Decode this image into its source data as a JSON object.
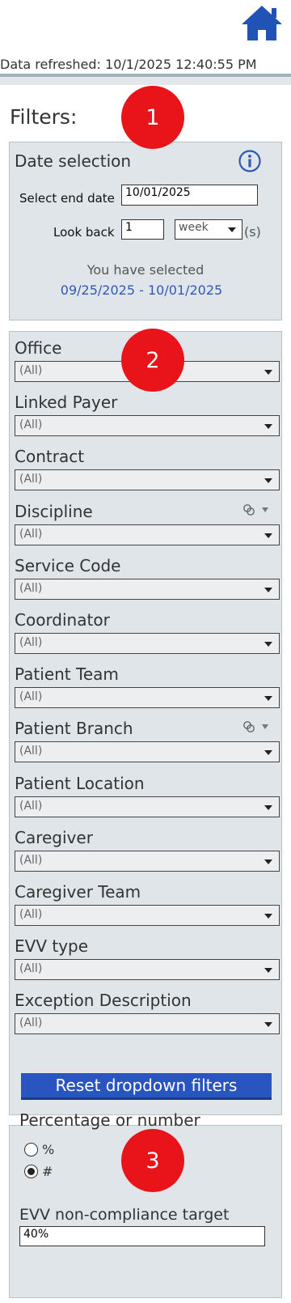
{
  "header": {
    "refresh_text": "Data refreshed: 10/1/2025 12:40:55 PM",
    "home_icon": "home-icon"
  },
  "filters_title": "Filters:",
  "badges": [
    "1",
    "2",
    "3"
  ],
  "date_panel": {
    "title": "Date selection",
    "info_icon": "info-icon",
    "end_date_label": "Select end date",
    "end_date_value": "10/01/2025",
    "lookback_label": "Look back",
    "lookback_value": "1",
    "unit_value": "week",
    "unit_suffix": "(s)",
    "selected_label": "You have selected",
    "selected_range": "09/25/2025 - 10/01/2025"
  },
  "dropdowns": [
    {
      "label": "Office",
      "value": "(All)"
    },
    {
      "label": "Linked Payer",
      "value": "(All)"
    },
    {
      "label": "Contract",
      "value": "(All)"
    },
    {
      "label": "Discipline",
      "value": "(All)"
    },
    {
      "label": "Service Code",
      "value": "(All)"
    },
    {
      "label": "Coordinator",
      "value": "(All)"
    },
    {
      "label": "Patient Team",
      "value": "(All)"
    },
    {
      "label": "Patient Branch",
      "value": "(All)"
    },
    {
      "label": "Patient Location",
      "value": "(All)"
    },
    {
      "label": "Caregiver",
      "value": "(All)"
    },
    {
      "label": "Caregiver Team",
      "value": "(All)"
    },
    {
      "label": "EVV type",
      "value": "(All)"
    },
    {
      "label": "Exception Description",
      "value": "(All)"
    }
  ],
  "reset_button": "Reset dropdown filters",
  "pct_panel": {
    "title": "Percentage or number",
    "option_pct": "%",
    "option_num": "#",
    "selected": "#",
    "target_label": "EVV non-compliance target",
    "target_value": "40%"
  },
  "colors": {
    "accent": "#2a55c0",
    "badge": "#e8141a",
    "panel": "#dfe5e8",
    "range_text": "#2f59b5"
  }
}
